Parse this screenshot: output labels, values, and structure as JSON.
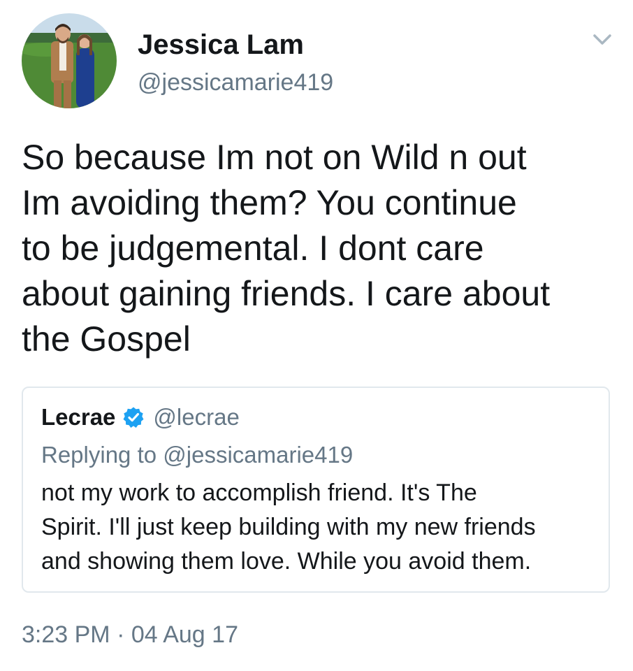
{
  "author": {
    "display_name": "Jessica Lam",
    "handle": "@jessicamarie419"
  },
  "tweet": {
    "text": "So because Im not on Wild n out\nIm avoiding them? You continue\nto be judgemental. I dont care\nabout gaining friends. I care about\nthe Gospel",
    "timestamp": "3:23 PM · 04 Aug 17"
  },
  "quoted_tweet": {
    "display_name": "Lecrae",
    "handle": "@lecrae",
    "verified": true,
    "replying_to": "Replying to @jessicamarie419",
    "text": "not my work to accomplish friend. It's The\nSpirit. I'll just keep building with my new friends\nand showing them love. While you avoid them."
  },
  "icons": {
    "menu": "chevron-down-icon",
    "verified": "verified-badge-icon"
  },
  "colors": {
    "primary_text": "#14171a",
    "secondary_text": "#657786",
    "verified_blue": "#1da1f2",
    "card_border": "#e1e8ed"
  }
}
